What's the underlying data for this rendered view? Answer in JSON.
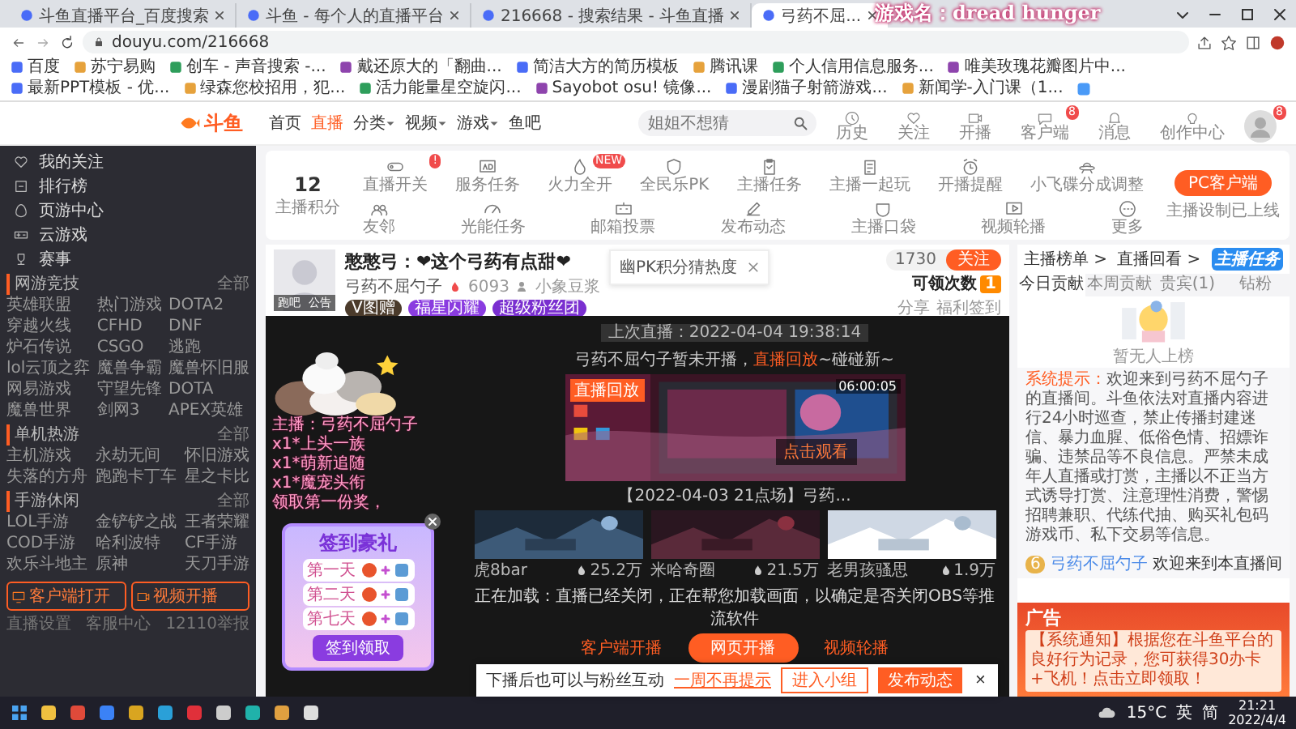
{
  "browser": {
    "tabs": [
      {
        "title": "斗鱼直播平台_百度搜索",
        "selected": false
      },
      {
        "title": "斗鱼 - 每个人的直播平台",
        "selected": false
      },
      {
        "title": "216668 - 搜索结果 - 斗鱼直播",
        "selected": false
      },
      {
        "title": "弓药不屈...",
        "selected": true
      }
    ],
    "overlay_text": "游戏名：dread hunger",
    "address": "douyu.com/216668",
    "bookmarks": [
      "百度",
      "苏宁易购",
      "创车 - 声音搜索 -...",
      "戴还原大的「翻曲...",
      "简洁大方的简历模板",
      "腾讯课",
      "个人信用信息服务...",
      "唯美玫瑰花瓣图片中...",
      "最新PPT模板 - 优...",
      "绿森您校招用，犯...",
      "活力能量星空旋闪...",
      "Sayobot osu! 镜像...",
      "漫剧猫子射箭游戏...",
      "新闻学-入门课（1..."
    ]
  },
  "header": {
    "logo": "斗鱼",
    "nav": [
      {
        "label": "首页",
        "selected": false,
        "dropdown": false
      },
      {
        "label": "直播",
        "selected": true,
        "dropdown": false
      },
      {
        "label": "分类",
        "selected": false,
        "dropdown": true
      },
      {
        "label": "视频",
        "selected": false,
        "dropdown": true
      },
      {
        "label": "游戏",
        "selected": false,
        "dropdown": true
      },
      {
        "label": "鱼吧",
        "selected": false,
        "dropdown": false
      }
    ],
    "search": {
      "placeholder": "姐姐不想猜"
    },
    "actions": [
      {
        "label": "历史"
      },
      {
        "label": "关注"
      },
      {
        "label": "开播"
      },
      {
        "label": "客户端",
        "badge": "8"
      },
      {
        "label": "消息"
      },
      {
        "label": "创作中心"
      }
    ],
    "avatar_badge": "8"
  },
  "sidebar": {
    "items": [
      "我的关注",
      "排行榜",
      "页游中心",
      "云游戏",
      "赛事"
    ],
    "sections": [
      {
        "title": "网游竞技",
        "more": "全部",
        "games": [
          "英雄联盟",
          "热门游戏",
          "DOTA2",
          "穿越火线",
          "CFHD",
          "DNF",
          "炉石传说",
          "CSGO",
          "逃跑",
          "lol云顶之弈",
          "魔兽争霸",
          "魔兽怀旧服",
          "网易游戏",
          "守望先锋",
          "DOTA",
          "魔兽世界",
          "剑网3",
          "APEX英雄"
        ]
      },
      {
        "title": "单机热游",
        "more": "全部",
        "games": [
          "主机游戏",
          "永劫无间",
          "怀旧游戏",
          "失落的方舟",
          "跑跑卡丁车",
          "星之卡比"
        ]
      },
      {
        "title": "手游休闲",
        "more": "全部",
        "games": [
          "LOL手游",
          "金铲铲之战",
          "王者荣耀",
          "COD手游",
          "哈利波特",
          "CF手游",
          "欢乐斗地主",
          "原神",
          "天刀手游"
        ]
      }
    ],
    "buttons": [
      "客户端打开",
      "视频开播"
    ],
    "footer": [
      "直播设置",
      "客服中心",
      "12110举报"
    ]
  },
  "toolbar": {
    "score": "12",
    "score_label": "主播积分",
    "items": [
      {
        "label": "直播开关",
        "badge": "!"
      },
      {
        "label": "服务任务"
      },
      {
        "label": "火力全开",
        "badge": "NEW"
      },
      {
        "label": "全民乐PK"
      },
      {
        "label": "主播任务"
      },
      {
        "label": "主播一起玩"
      },
      {
        "label": "开播提醒"
      },
      {
        "label": "小飞碟分成调整"
      },
      {
        "label": "友邻"
      },
      {
        "label": "光能任务"
      },
      {
        "label": "邮箱投票"
      },
      {
        "label": "发布动态"
      },
      {
        "label": "主播口袋"
      },
      {
        "label": "视频轮播"
      },
      {
        "label": "更多"
      }
    ],
    "pc_button": "PC客户端",
    "pc_note": "主播设制已上线"
  },
  "streamer": {
    "avatar_tabs": [
      "跑吧",
      "公告"
    ],
    "title": "憨憨弓：❤这个弓药有点甜❤",
    "name": "弓药不屈勺子",
    "heat": "6093",
    "group": "小象豆浆",
    "badges": [
      "V图赠",
      "福星闪耀",
      "超级粉丝团"
    ],
    "followers": "1730",
    "follow": "关注",
    "claim": "可领次数",
    "claim_count": "1",
    "share": "分享",
    "welfare": "福利签到",
    "pk_text": "幽PK积分猜热度"
  },
  "video": {
    "last_live": "上次直播：2022-04-04 19:38:14",
    "offline": "弓药不屈勺子暂未开播，",
    "replay_link": "直播回放",
    "replay_rest": "~碰碰新~",
    "preview": {
      "badge": "直播回放",
      "play": "点击观看",
      "time": "06:00:05",
      "caption": "【2022-04-03 21点场】弓药..."
    },
    "recommend": [
      {
        "name": "虎8bar",
        "views": "25.2万"
      },
      {
        "name": "米哈奇圈",
        "views": "21.5万"
      },
      {
        "name": "老男孩骚思",
        "views": "1.9万"
      }
    ],
    "loading": "正在加载：直播已经关闭，正在帮您加载画面，以确定是否关闭OBS等推流软件",
    "buttons": [
      {
        "label": "客户端开播",
        "kind": "link"
      },
      {
        "label": "网页开播",
        "kind": "primary"
      },
      {
        "label": "视频轮播",
        "kind": "link"
      }
    ]
  },
  "sticker_lines": [
    "主播：弓药不屈勺子",
    "x1*上头一族",
    "x1*萌新追随",
    "x1*魔宠头衔",
    "领取第一份奖，"
  ],
  "signin": {
    "title": "签到豪礼",
    "days": [
      "第一天",
      "第二天",
      "第七天"
    ],
    "button": "签到领取"
  },
  "right_panel": {
    "links": [
      "主播榜单 >",
      "直播回看 >"
    ],
    "task_badge": "主播任务",
    "tabs": [
      {
        "label": "今日贡献",
        "selected": true
      },
      {
        "label": "本周贡献",
        "selected": false
      },
      {
        "label": "贵宾(1)",
        "selected": false
      },
      {
        "label": "钻粉",
        "selected": false
      }
    ],
    "empty": "暂无人上榜",
    "system_label": "系统提示：",
    "system_text": "欢迎来到弓药不屈勺子的直播间。斗鱼依法对直播内容进行24小时巡查，禁止传播封建迷信、暴力血腥、低俗色情、招嫖诈骗、违禁品等不良信息。严禁未成年人直播或打赏，主播以不正当方式诱导打赏、注意理性消费，警惕招聘兼职、代练代抽、购买礼包码游戏币、私下交易等信息。",
    "welcome_level": "6",
    "welcome_user": "弓药不屈勺子",
    "welcome_text": "欢迎来到本直播间",
    "ad_label": "广告",
    "ad_text": "【系统通知】根据您在斗鱼平台的良好行为记录，您可获得30办卡+飞机！点击立即领取！"
  },
  "bottom_popup": {
    "text": "下播后也可以与粉丝互动",
    "link": "一周不再提示",
    "buttons": [
      "进入小组",
      "发布动态"
    ],
    "close": "×"
  },
  "taskbar": {
    "ime": [
      "英",
      "简"
    ],
    "weather": "15°C",
    "time": "21:21",
    "date": "2022/4/4"
  }
}
